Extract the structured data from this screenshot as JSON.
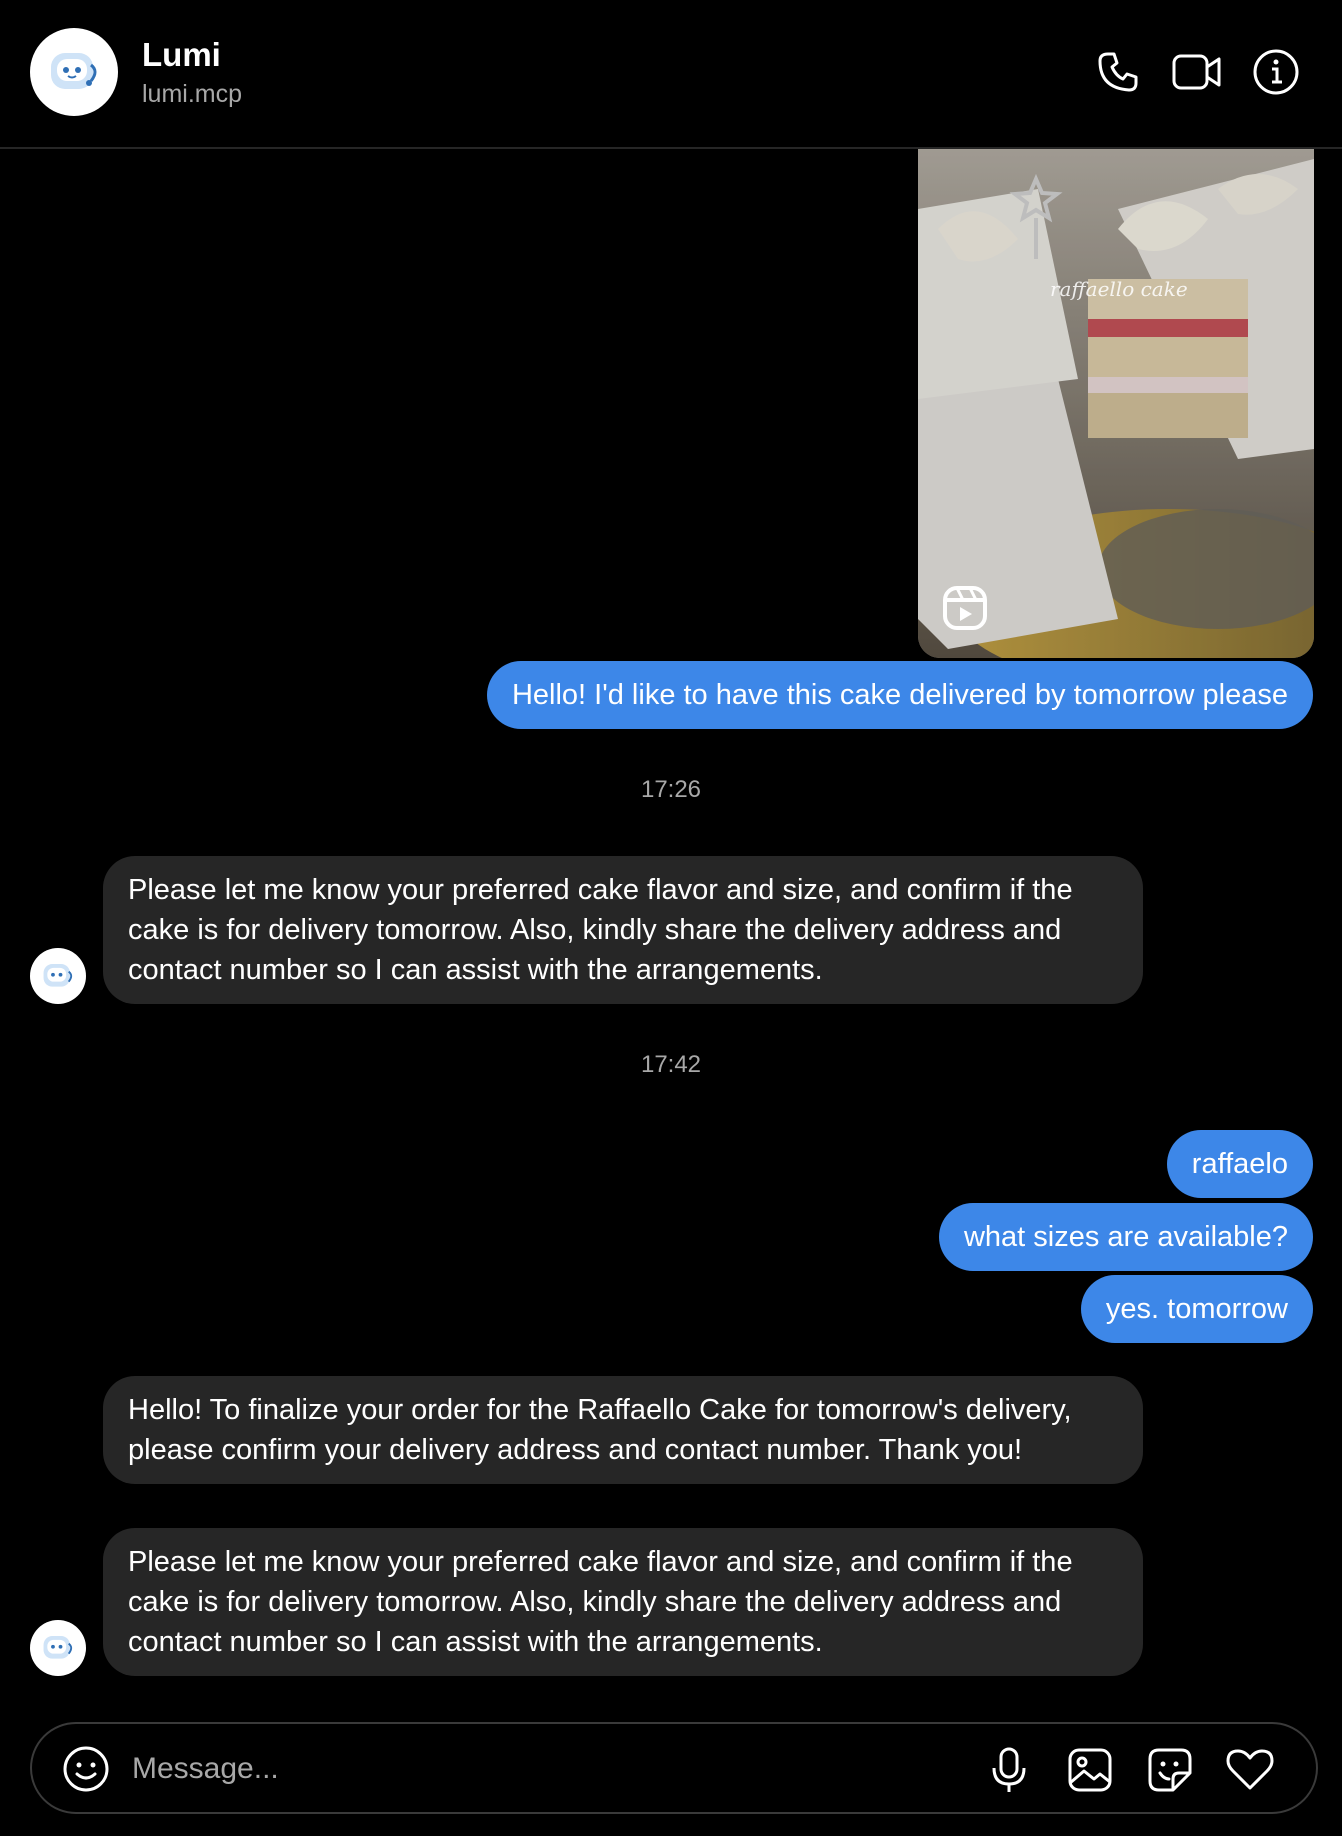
{
  "header": {
    "name": "Lumi",
    "handle": "lumi.mcp",
    "icons": [
      "phone-icon",
      "video-icon",
      "info-icon"
    ]
  },
  "media": {
    "caption": "raffaello cake",
    "badge_icon": "reels-icon"
  },
  "messages": {
    "m1": "Hello! I'd like to have this cake delivered by tomorrow please",
    "t1": "17:26",
    "m2": "Please let me know your preferred cake flavor and size, and confirm if the cake is for delivery tomorrow. Also, kindly share the delivery address and contact number so I can assist with the arrangements.",
    "t2": "17:42",
    "m3": "raffaelo",
    "m4": "what sizes are available?",
    "m5": "yes. tomorrow",
    "m6": "Hello! To finalize your order for the Raffaello Cake for tomorrow's delivery, please confirm your delivery address and contact number. Thank you!",
    "m7": "Please let me know your preferred cake flavor and size, and confirm if the cake is for delivery tomorrow. Also, kindly share the delivery address and contact number so I can assist with the arrangements."
  },
  "composer": {
    "placeholder": "Message...",
    "icons": [
      "emoji-icon",
      "microphone-icon",
      "image-icon",
      "sticker-icon",
      "heart-icon"
    ]
  },
  "colors": {
    "outgoing_bubble": "#3d87e8",
    "incoming_bubble": "#262626",
    "background": "#000000",
    "secondary_text": "#a8a8a8"
  }
}
